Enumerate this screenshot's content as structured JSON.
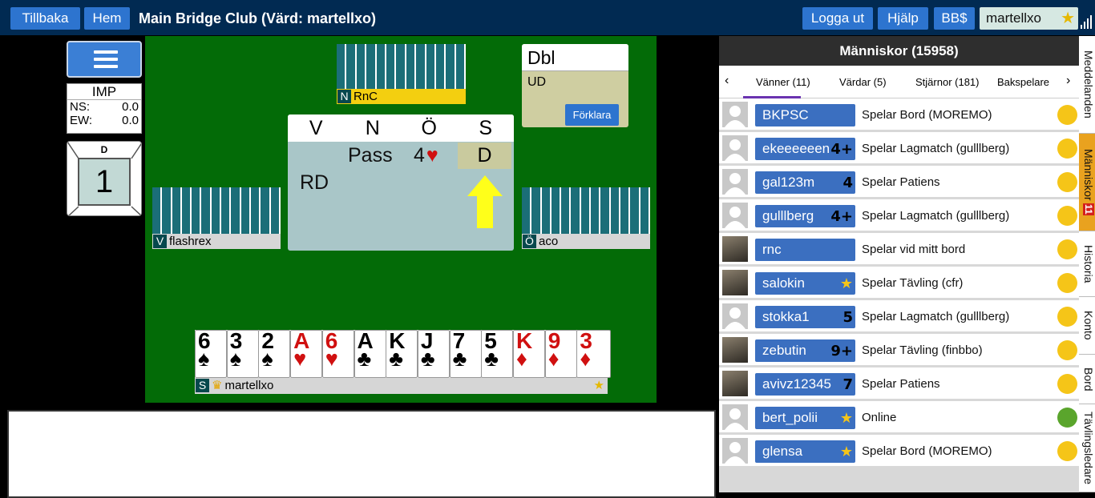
{
  "topbar": {
    "back_label": "Tillbaka",
    "home_label": "Hem",
    "title": "Main Bridge Club (Värd: martellxo)",
    "logout_label": "Logga ut",
    "help_label": "Hjälp",
    "bb_label": "BB$",
    "username": "martellxo"
  },
  "score": {
    "type": "IMP",
    "ns_label": "NS:",
    "ns_value": "0.0",
    "ew_label": "EW:",
    "ew_value": "0.0"
  },
  "deal": {
    "dealer": "D",
    "number": "1"
  },
  "players": {
    "north": {
      "seat": "N",
      "name": "RnC"
    },
    "west": {
      "seat": "V",
      "name": "flashrex"
    },
    "east": {
      "seat": "Ö",
      "name": "aco"
    },
    "south": {
      "seat": "S",
      "name": "martellxo"
    }
  },
  "auction": {
    "headers": [
      "V",
      "N",
      "Ö",
      "S"
    ],
    "bid_pass": "Pass",
    "bid_level": "4",
    "bid_suit": "♥",
    "bid_double": "D",
    "rd_label": "RD"
  },
  "explain": {
    "title": "Dbl",
    "meaning": "UD",
    "button_label": "Förklara"
  },
  "hand": [
    {
      "rank": "6",
      "suit": "♠",
      "color": "#000"
    },
    {
      "rank": "3",
      "suit": "♠",
      "color": "#000"
    },
    {
      "rank": "2",
      "suit": "♠",
      "color": "#000"
    },
    {
      "rank": "A",
      "suit": "♥",
      "color": "#d01010"
    },
    {
      "rank": "6",
      "suit": "♥",
      "color": "#d01010"
    },
    {
      "rank": "A",
      "suit": "♣",
      "color": "#000"
    },
    {
      "rank": "K",
      "suit": "♣",
      "color": "#000"
    },
    {
      "rank": "J",
      "suit": "♣",
      "color": "#000"
    },
    {
      "rank": "7",
      "suit": "♣",
      "color": "#000"
    },
    {
      "rank": "5",
      "suit": "♣",
      "color": "#000"
    },
    {
      "rank": "K",
      "suit": "♦",
      "color": "#d01010"
    },
    {
      "rank": "9",
      "suit": "♦",
      "color": "#d01010"
    },
    {
      "rank": "3",
      "suit": "♦",
      "color": "#d01010"
    }
  ],
  "people": {
    "header": "Människor (15958)",
    "tabs": [
      "Vänner (11)",
      "Värdar (5)",
      "Stjärnor (181)",
      "Bakspelare"
    ],
    "rows": [
      {
        "name": "BKPSC",
        "badge": "",
        "status": "Spelar Bord (MOREMO)",
        "dot": "#f5c518",
        "avatar": "default"
      },
      {
        "name": "ekeeeeeen",
        "badge": "4+",
        "status": "Spelar Lagmatch (gulllberg)",
        "dot": "#f5c518",
        "avatar": "default"
      },
      {
        "name": "gal123m",
        "badge": "4",
        "status": "Spelar Patiens",
        "dot": "#f5c518",
        "avatar": "default"
      },
      {
        "name": "gulllberg",
        "badge": "4+",
        "status": "Spelar Lagmatch (gulllberg)",
        "dot": "#f5c518",
        "avatar": "default"
      },
      {
        "name": "rnc",
        "badge": "",
        "status": "Spelar vid mitt bord",
        "dot": "#f5c518",
        "avatar": "photo"
      },
      {
        "name": "salokin",
        "badge": "★",
        "status": "Spelar Tävling (cfr)",
        "dot": "#f5c518",
        "avatar": "photo"
      },
      {
        "name": "stokka1",
        "badge": "5",
        "status": "Spelar Lagmatch (gulllberg)",
        "dot": "#f5c518",
        "avatar": "default"
      },
      {
        "name": "zebutin",
        "badge": "9+",
        "status": "Spelar Tävling (finbbo)",
        "dot": "#f5c518",
        "avatar": "photo"
      },
      {
        "name": "avivz12345",
        "badge": "7",
        "status": "Spelar Patiens",
        "dot": "#f5c518",
        "avatar": "photo"
      },
      {
        "name": "bert_polii",
        "badge": "★",
        "status": "Online",
        "dot": "#5aa52c",
        "avatar": "default"
      },
      {
        "name": "glensa",
        "badge": "★",
        "status": "Spelar Bord (MOREMO)",
        "dot": "#f5c518",
        "avatar": "default"
      }
    ]
  },
  "side_tabs": [
    {
      "label": "Meddelanden",
      "badge": ""
    },
    {
      "label": "Människor",
      "badge": "11"
    },
    {
      "label": "Historia",
      "badge": ""
    },
    {
      "label": "Konto",
      "badge": ""
    },
    {
      "label": "Bord",
      "badge": ""
    },
    {
      "label": "Tävlingsledare",
      "badge": ""
    }
  ]
}
